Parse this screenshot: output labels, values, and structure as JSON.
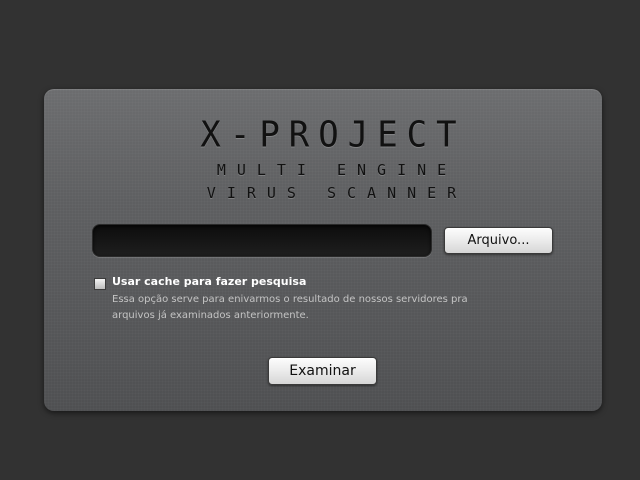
{
  "logo": {
    "title": "X-PROJECT",
    "subtitle_line1": "MULTI ENGINE",
    "subtitle_line2": "VIRUS SCANNER"
  },
  "file_picker": {
    "value": "",
    "placeholder": "",
    "browse_label": "Arquivo..."
  },
  "cache_option": {
    "checked": false,
    "label": "Usar cache para fazer pesquisa",
    "description": "Essa opção serve para enivarmos o resultado de nossos servidores pra arquivos já examinados anteriormente."
  },
  "scan_button": {
    "label": "Examinar"
  },
  "colors": {
    "background": "#323232",
    "panel": "#5e5f61",
    "logo_text": "#111111",
    "label_text": "#ffffff",
    "description_text": "#c4c4c4"
  }
}
